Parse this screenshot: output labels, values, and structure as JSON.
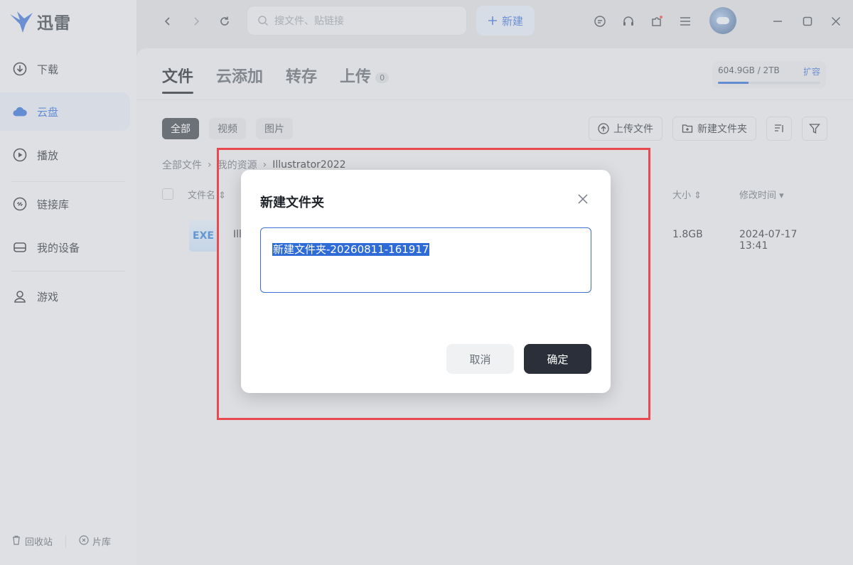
{
  "app": {
    "name": "迅雷"
  },
  "sidebar": {
    "items": [
      {
        "label": "下载",
        "icon": "download-icon"
      },
      {
        "label": "云盘",
        "icon": "cloud-icon"
      },
      {
        "label": "播放",
        "icon": "play-icon"
      },
      {
        "label": "链接库",
        "icon": "link-icon"
      },
      {
        "label": "我的设备",
        "icon": "device-icon"
      },
      {
        "label": "游戏",
        "icon": "user-icon"
      }
    ],
    "active_index": 1,
    "bottom": {
      "recycle": "回收站",
      "library": "片库"
    }
  },
  "topbar": {
    "search_placeholder": "搜文件、贴链接",
    "new_label": "新建"
  },
  "main": {
    "tabs": [
      {
        "label": "文件"
      },
      {
        "label": "云添加"
      },
      {
        "label": "转存"
      },
      {
        "label": "上传",
        "badge": "0"
      }
    ],
    "storage": {
      "used": "604.9GB / 2TB",
      "expand": "扩容",
      "used_fraction": 0.3
    },
    "filters": [
      "全部",
      "视频",
      "图片"
    ],
    "actions": {
      "upload": "上传文件",
      "new_folder": "新建文件夹"
    },
    "breadcrumb": [
      "全部文件",
      "我的资源",
      "Illustrator2022"
    ],
    "table": {
      "headers": {
        "name": "文件名",
        "size": "大小",
        "modified": "修改时间"
      },
      "rows": [
        {
          "type": "EXE",
          "name": "Ill",
          "size": "1.8GB",
          "modified": "2024-07-17 13:41"
        }
      ]
    }
  },
  "dialog": {
    "title": "新建文件夹",
    "input_value": "新建文件夹-20260811-161917",
    "cancel": "取消",
    "confirm": "确定"
  },
  "colors": {
    "accent": "#2f6bd6",
    "highlight_border": "#e84a4f",
    "confirm_bg": "#2a2f39"
  }
}
